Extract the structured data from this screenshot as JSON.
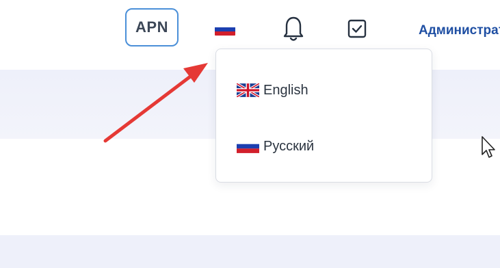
{
  "header": {
    "badge_label": "APN",
    "language_icon": "flag-ru-icon",
    "notification_icon": "bell-icon",
    "tasks_icon": "checkbox-icon",
    "user_label": "Администратор"
  },
  "language_menu": {
    "items": [
      {
        "label": "English",
        "icon": "flag-uk-icon"
      },
      {
        "label": "Русский",
        "icon": "flag-ru-icon"
      }
    ]
  },
  "colors": {
    "accent": "#1f4fa3",
    "badge_border": "#4a8fd8",
    "annotation_arrow": "#e53935",
    "band": "#eef0fa"
  }
}
